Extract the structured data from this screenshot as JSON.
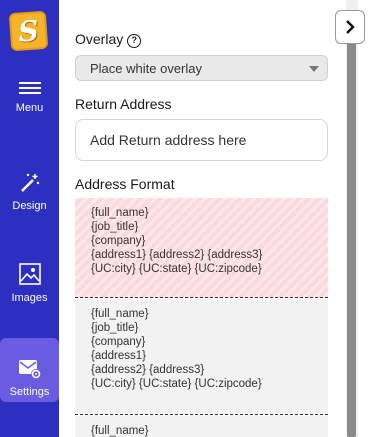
{
  "sidebar": {
    "logo_letter": "S",
    "items": [
      {
        "label": "Menu",
        "icon": "hamburger-icon"
      },
      {
        "label": "Design",
        "icon": "magic-wand-icon"
      },
      {
        "label": "Images",
        "icon": "image-icon"
      },
      {
        "label": "Settings",
        "icon": "envelope-gear-icon",
        "active": true
      }
    ]
  },
  "panel": {
    "overlay_label": "Overlay",
    "overlay_help": "?",
    "overlay_value": "Place white overlay",
    "return_label": "Return Address",
    "return_placeholder": "Add Return address here",
    "format_label": "Address Format",
    "formats": [
      {
        "lines": [
          "{full_name}",
          "{job_title}",
          "{company}",
          "{address1} {address2} {address3}",
          "{UC:city} {UC:state} {UC:zipcode}"
        ],
        "selected": true
      },
      {
        "lines": [
          "{full_name}",
          "{job_title}",
          "{company}",
          "{address1}",
          "{address2} {address3}",
          "{UC:city} {UC:state} {UC:zipcode}"
        ],
        "selected": false
      },
      {
        "lines": [
          "{full_name}"
        ],
        "selected": false
      }
    ]
  },
  "colors": {
    "sidebar": "#2c2fc0",
    "active_nav": "#6a5ce0",
    "selected_format": "#fdd9dd"
  }
}
